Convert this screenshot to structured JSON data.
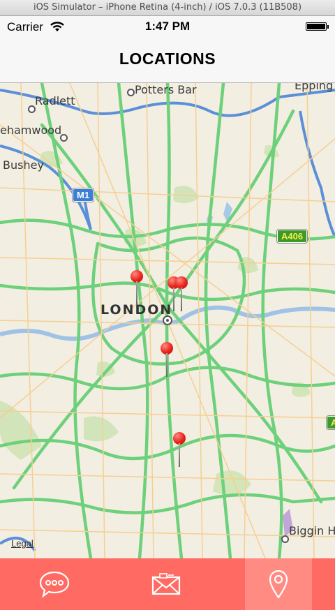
{
  "simulator": {
    "title": "iOS Simulator – iPhone Retina (4-inch) / iOS 7.0.3 (11B508)"
  },
  "status_bar": {
    "carrier": "Carrier",
    "time": "1:47 PM",
    "wifi_icon": "wifi-icon",
    "battery_icon": "battery-icon",
    "battery_level": 1.0
  },
  "nav": {
    "title": "LOCATIONS"
  },
  "map": {
    "labels": {
      "potters_bar": "Potters Bar",
      "radlett": "Radlett",
      "borehamwood": "ehamwood",
      "bushey": "Bushey",
      "london": "LONDON",
      "epping": "Epping",
      "biggin_hill": "Biggin H",
      "m1": "M1",
      "a406": "A406",
      "a_edge": "A"
    },
    "legal": "Legal",
    "pin_count": 5
  },
  "tabbar": {
    "tabs": [
      {
        "icon": "chat-bubble-icon",
        "active": false
      },
      {
        "icon": "envelope-icon",
        "active": false
      },
      {
        "icon": "location-pin-icon",
        "active": true
      }
    ],
    "colors": {
      "background": "#ff6b63",
      "active": "#ff8b82"
    }
  }
}
